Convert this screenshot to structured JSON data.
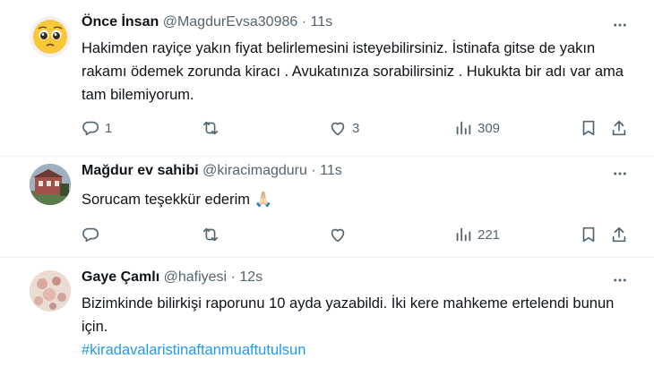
{
  "tweets": [
    {
      "name": "Önce İnsan",
      "handle": "@MagdurEvsa30986",
      "dot": "·",
      "time": "11s",
      "text": "Hakimden rayiçe yakın fiyat belirlemesini isteyebilirsiniz. İstinafa gitse de yakın rakamı ödemek zorunda kiracı . Avukatınıza sorabilirsiniz . Hukukta bir adı var ama tam bilemiyorum.",
      "replies": "1",
      "retweets": "",
      "likes": "3",
      "views": "309"
    },
    {
      "name": "Mağdur ev sahibi",
      "handle": "@kiracimagduru",
      "dot": "·",
      "time": "11s",
      "text": "Sorucam teşekkür ederim",
      "emoji": "🙏🏻",
      "replies": "",
      "retweets": "",
      "likes": "",
      "views": "221"
    },
    {
      "name": "Gaye Çamlı",
      "handle": "@hafiyesi",
      "dot": "·",
      "time": "12s",
      "text": "Bizimkinde bilirkişi raporunu 10 ayda yazabildi. İki kere mahkeme ertelendi bunun için.",
      "hashtag": "#kiradavalaristinaftanmuaftutulsun"
    }
  ],
  "colors": {
    "text": "#0f1419",
    "secondary": "#536471",
    "link": "#1d9bf0",
    "divider": "#eff3f4"
  },
  "icons": [
    "pleading-face-emoji-avatar",
    "reply-icon",
    "retweet-icon",
    "like-icon",
    "views-icon",
    "bookmark-icon",
    "share-icon",
    "more-icon"
  ]
}
